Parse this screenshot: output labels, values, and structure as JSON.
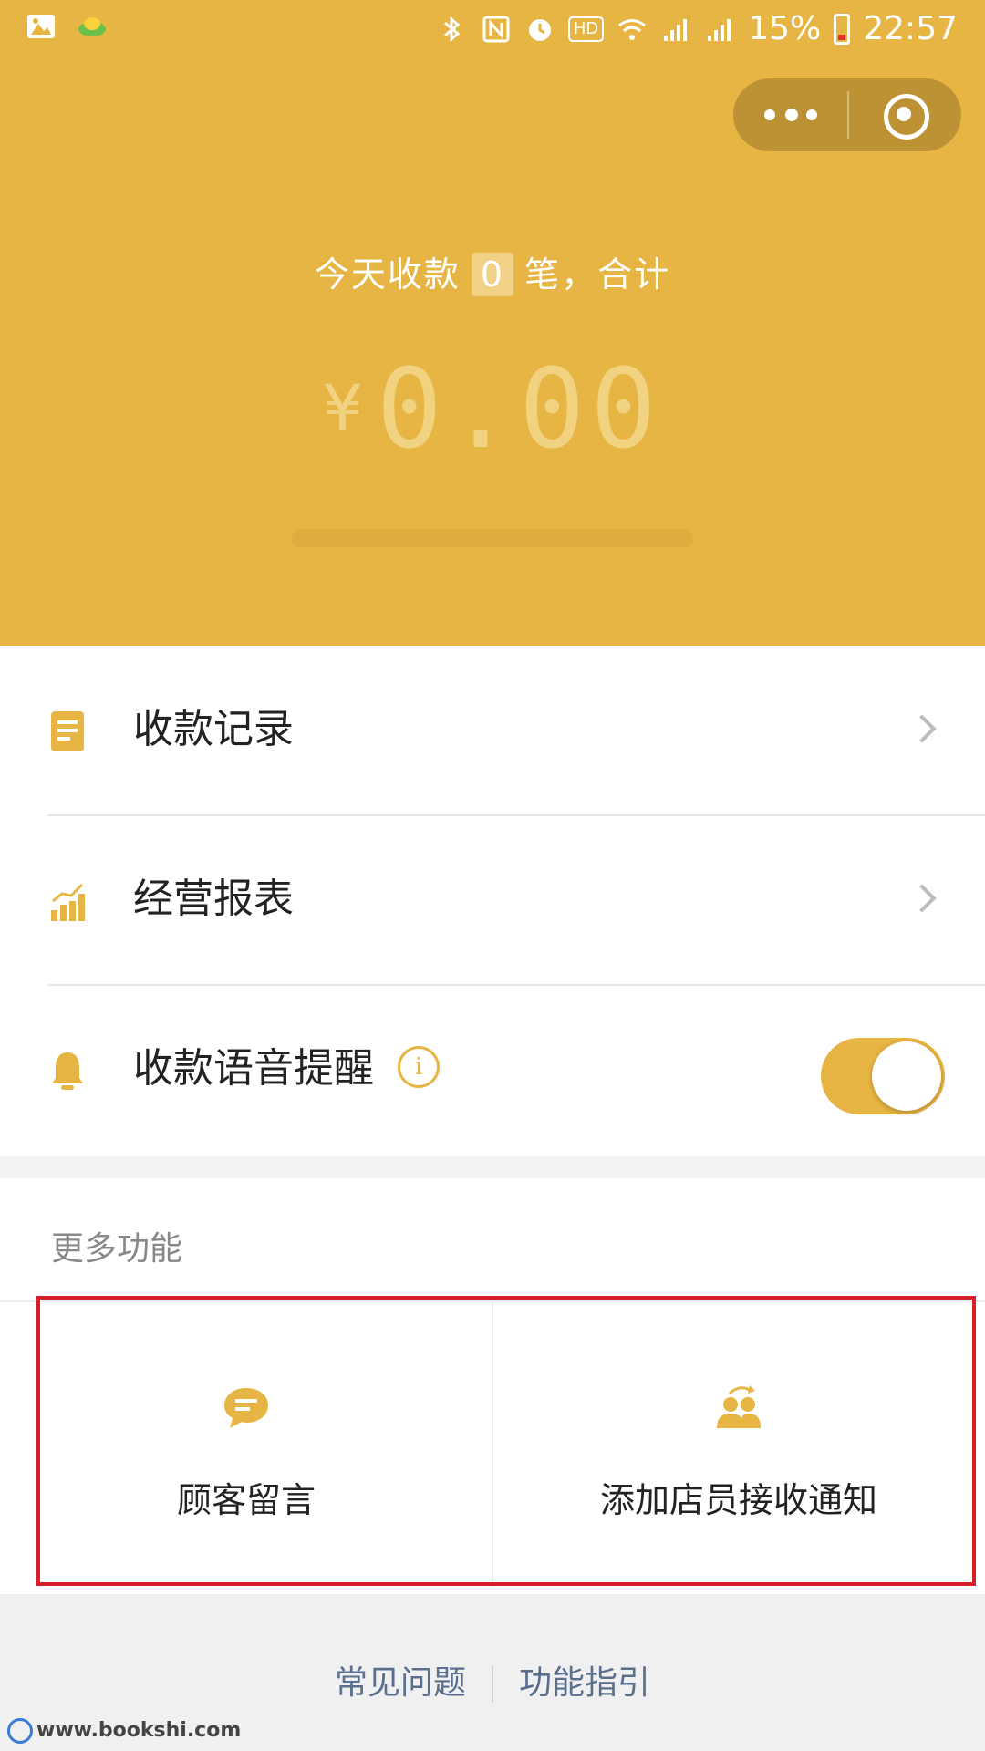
{
  "status_bar": {
    "battery_percent": "15%",
    "time": "22:57",
    "hd_label": "HD"
  },
  "header": {
    "today_prefix": "今天收款",
    "today_count": "0",
    "today_suffix": "笔，合计",
    "currency": "¥",
    "amount": "0.00"
  },
  "list": {
    "items": [
      {
        "label": "收款记录"
      },
      {
        "label": "经营报表"
      },
      {
        "label": "收款语音提醒"
      }
    ],
    "info_glyph": "i"
  },
  "more": {
    "title": "更多功能",
    "features": [
      {
        "label": "顾客留言"
      },
      {
        "label": "添加店员接收通知"
      }
    ]
  },
  "footer": {
    "faq": "常见问题",
    "guide": "功能指引"
  },
  "watermark": "www.bookshi.com",
  "colors": {
    "accent": "#e7b543",
    "highlight_border": "#d9202a"
  }
}
